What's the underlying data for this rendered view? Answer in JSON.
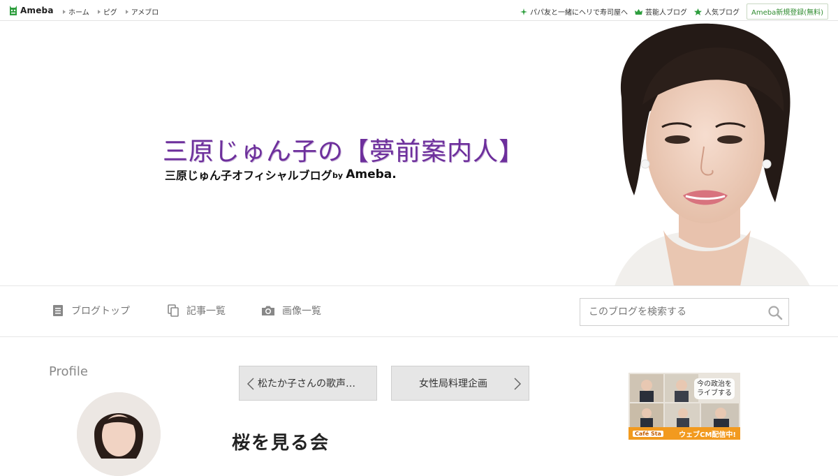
{
  "topbar": {
    "logo_text": "Ameba",
    "nav": [
      {
        "label": "ホーム"
      },
      {
        "label": "ピグ"
      },
      {
        "label": "アメブロ"
      }
    ],
    "right_links": [
      {
        "label": "パパ友と一緒にヘリで寿司屋へ",
        "icon": "sparkle-icon"
      },
      {
        "label": "芸能人ブログ",
        "icon": "crown-icon"
      },
      {
        "label": "人気ブログ",
        "icon": "star-icon"
      }
    ],
    "register_label": "Ameba新規登録(無料)"
  },
  "banner": {
    "title": "三原じゅん子の【夢前案内人】",
    "subtitle": "三原じゅん子オフィシャルブログ",
    "by": "by",
    "brand": "Ameba."
  },
  "blognav": {
    "items": [
      {
        "label": "ブログトップ",
        "icon": "document-icon"
      },
      {
        "label": "記事一覧",
        "icon": "copy-icon"
      },
      {
        "label": "画像一覧",
        "icon": "camera-icon"
      }
    ],
    "search_placeholder": "このブログを検索する"
  },
  "sidebar": {
    "profile_heading": "Profile"
  },
  "article": {
    "prev_label": "松たか子さんの歌声…",
    "next_label": "女性局料理企画",
    "title": "桜を見る会"
  },
  "ad": {
    "caption_line1": "今の政治を",
    "caption_line2": "ライブする",
    "brand": "Café Sta",
    "bar_text": "ウェブCM配信中!"
  },
  "colors": {
    "title_purple": "#6d2f9c",
    "ameba_green": "#2e8b2e",
    "ad_orange": "#f29a1f"
  }
}
